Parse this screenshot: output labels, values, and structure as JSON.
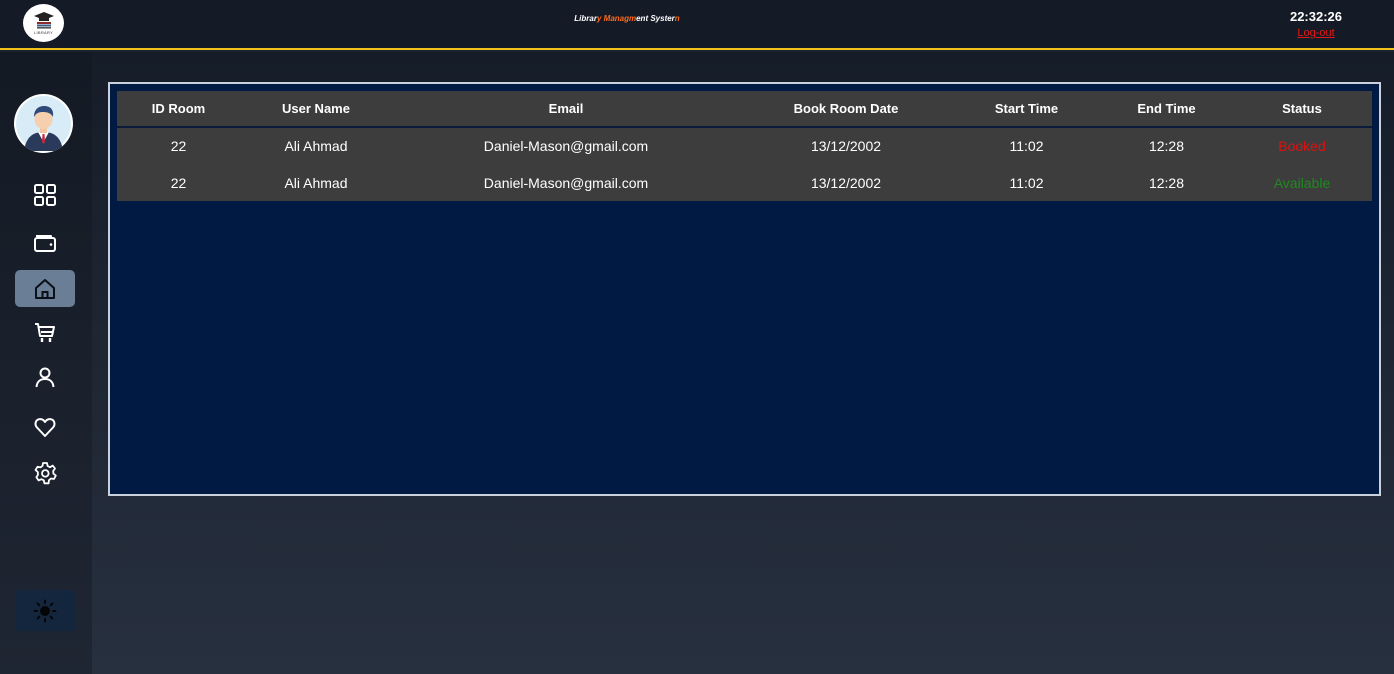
{
  "header": {
    "logo_text": "LIBRARY",
    "title_parts": [
      "Librar",
      "y",
      " ",
      "Managm",
      "ent Syster",
      "n"
    ],
    "clock": "22:32:26",
    "logout_label": "Log-out"
  },
  "sidebar": {
    "items": [
      {
        "name": "dashboard",
        "icon": "grid-icon",
        "active": false
      },
      {
        "name": "wallet",
        "icon": "wallet-icon",
        "active": false
      },
      {
        "name": "home",
        "icon": "home-icon",
        "active": true
      },
      {
        "name": "cart",
        "icon": "cart-icon",
        "active": false
      },
      {
        "name": "profile",
        "icon": "user-icon",
        "active": false
      },
      {
        "name": "favorites",
        "icon": "heart-icon",
        "active": false
      },
      {
        "name": "settings",
        "icon": "gear-icon",
        "active": false
      }
    ],
    "theme_toggle_icon": "sun-icon"
  },
  "table": {
    "columns": [
      "ID Room",
      "User Name",
      "Email",
      "Book Room Date",
      "Start Time",
      "End Time",
      "Status"
    ],
    "rows": [
      {
        "id": "22",
        "user": "Ali Ahmad",
        "email": "Daniel-Mason@gmail.com",
        "date": "13/12/2002",
        "start": "11:02",
        "end": "12:28",
        "status": "Booked"
      },
      {
        "id": "22",
        "user": "Ali Ahmad",
        "email": "Daniel-Mason@gmail.com",
        "date": "13/12/2002",
        "start": "11:02",
        "end": "12:28",
        "status": "Available"
      }
    ]
  },
  "colors": {
    "accent_border": "#f2c21a",
    "booked": "#e01010",
    "available": "#1d8a1d",
    "panel_bg": "#001a44",
    "active_nav": "#6a7e96"
  }
}
